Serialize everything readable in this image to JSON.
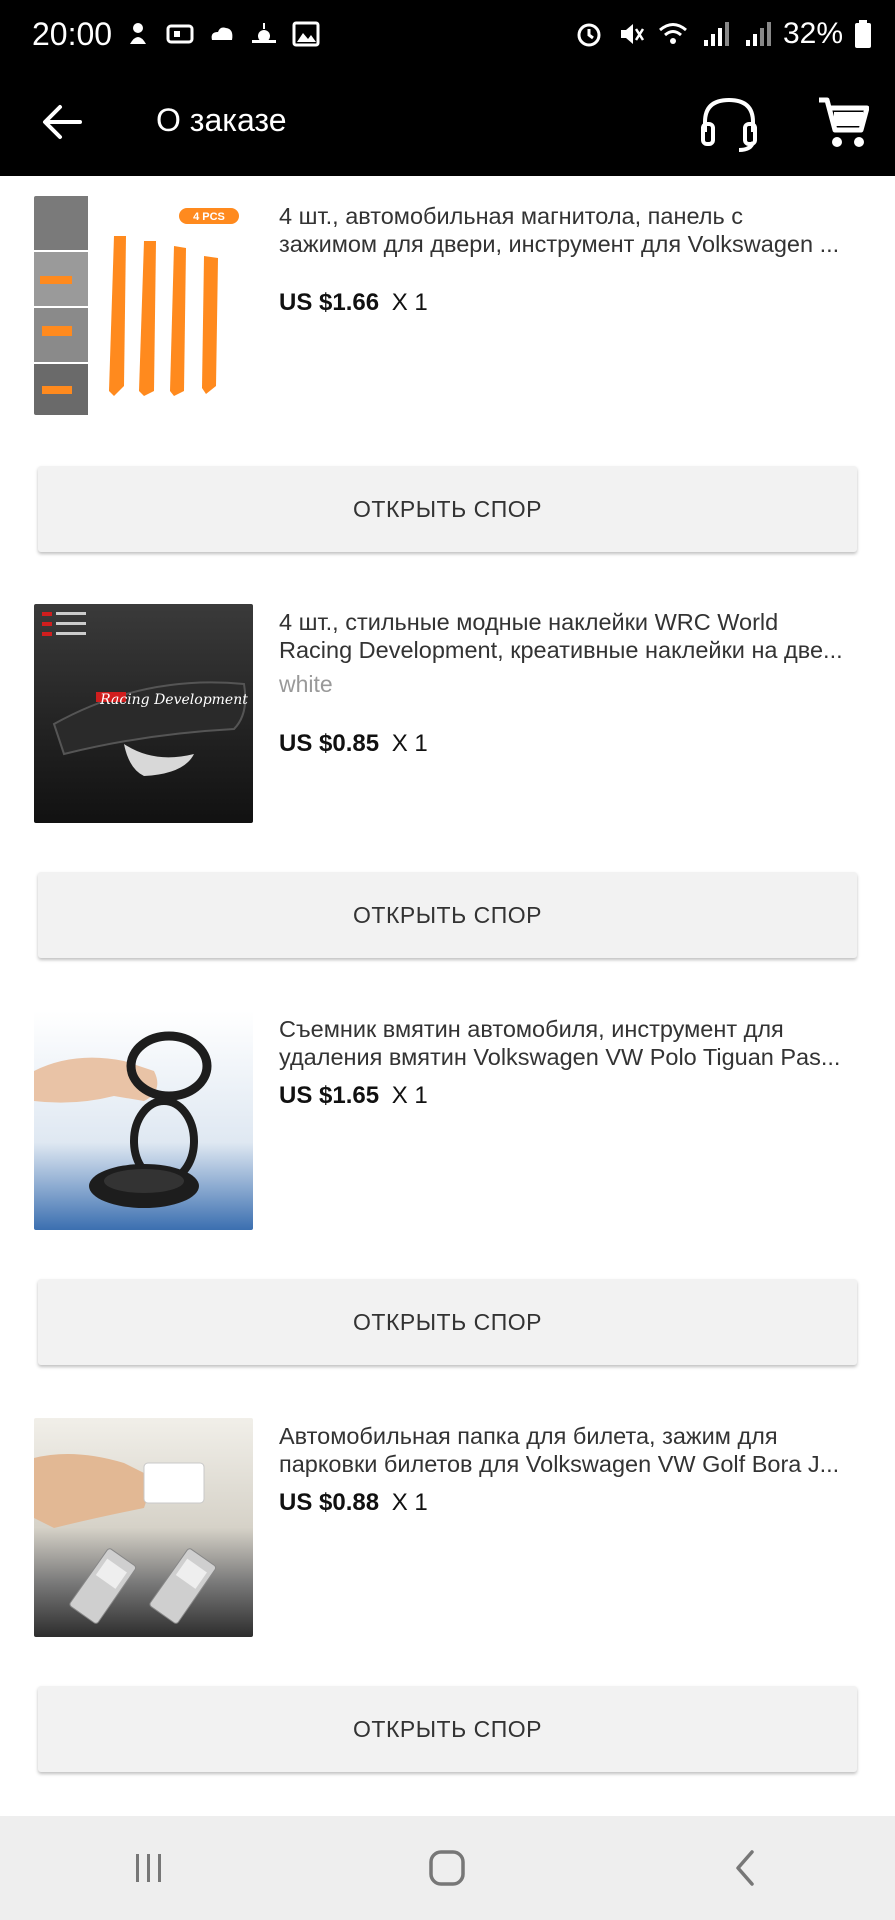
{
  "statusbar": {
    "time": "20:00",
    "battery": "32%"
  },
  "appbar": {
    "title": "О заказе"
  },
  "items": [
    {
      "title_line1": "4 шт., автомобильная магнитола, панель с",
      "title_line2": "зажимом для двери, инструмент для Volkswagen ...",
      "variant": "",
      "price": "US $1.66",
      "qty": "X 1",
      "thumb_badge": "4 PCS",
      "dispute_label": "ОТКРЫТЬ СПОР"
    },
    {
      "title_line1": "4 шт., стильные модные наклейки WRC World",
      "title_line2": "Racing Development, креативные наклейки на две...",
      "variant": "white",
      "price": "US $0.85",
      "qty": "X 1",
      "dispute_label": "ОТКРЫТЬ СПОР"
    },
    {
      "title_line1": "Съемник вмятин автомобиля, инструмент для",
      "title_line2": "удаления вмятин Volkswagen VW Polo Tiguan Pas...",
      "variant": "",
      "price": "US $1.65",
      "qty": "X 1",
      "dispute_label": "ОТКРЫТЬ СПОР"
    },
    {
      "title_line1": "Автомобильная папка для билета, зажим для",
      "title_line2": "парковки билетов для Volkswagen VW Golf Bora J...",
      "variant": "",
      "price": "US $0.88",
      "qty": "X 1",
      "dispute_label": "ОТКРЫТЬ СПОР"
    }
  ],
  "icons": {
    "back": "arrow-left-icon",
    "support": "headset-icon",
    "cart": "cart-icon",
    "nav_recent": "recent-apps-icon",
    "nav_home": "home-icon",
    "nav_back": "nav-back-icon"
  },
  "colors": {
    "appbar_bg": "#000000",
    "button_bg": "#f2f2f2",
    "accent_orange": "#ff8a1e"
  }
}
